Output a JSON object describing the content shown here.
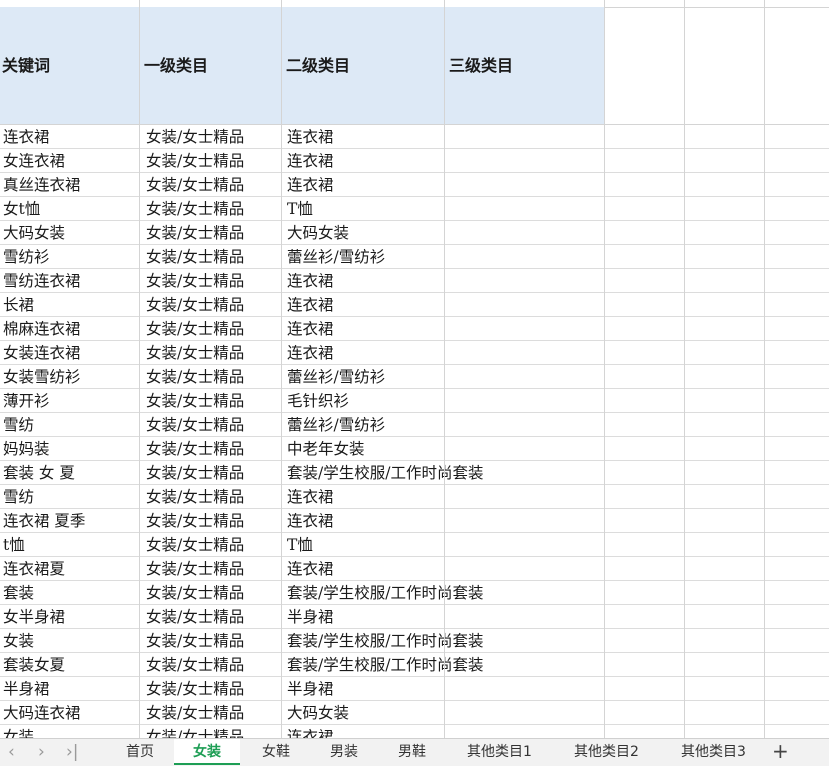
{
  "header": {
    "keyword": "关键词",
    "cat1": "一级类目",
    "cat2": "二级类目",
    "cat3": "三级类目"
  },
  "rows": [
    [
      "连衣裙",
      "女装/女士精品",
      "连衣裙"
    ],
    [
      "女连衣裙",
      "女装/女士精品",
      "连衣裙"
    ],
    [
      "真丝连衣裙",
      "女装/女士精品",
      "连衣裙"
    ],
    [
      "女t恤",
      "女装/女士精品",
      "T恤"
    ],
    [
      "大码女装",
      "女装/女士精品",
      "大码女装"
    ],
    [
      "雪纺衫",
      "女装/女士精品",
      "蕾丝衫/雪纺衫"
    ],
    [
      "雪纺连衣裙",
      "女装/女士精品",
      "连衣裙"
    ],
    [
      "长裙",
      "女装/女士精品",
      "连衣裙"
    ],
    [
      "棉麻连衣裙",
      "女装/女士精品",
      "连衣裙"
    ],
    [
      "女装连衣裙",
      "女装/女士精品",
      "连衣裙"
    ],
    [
      "女装雪纺衫",
      "女装/女士精品",
      "蕾丝衫/雪纺衫"
    ],
    [
      "薄开衫",
      "女装/女士精品",
      "毛针织衫"
    ],
    [
      "雪纺",
      "女装/女士精品",
      "蕾丝衫/雪纺衫"
    ],
    [
      "妈妈装",
      "女装/女士精品",
      "中老年女装"
    ],
    [
      "套装 女 夏",
      "女装/女士精品",
      "套装/学生校服/工作时尚套装"
    ],
    [
      "雪纺",
      "女装/女士精品",
      "连衣裙"
    ],
    [
      "连衣裙 夏季",
      "女装/女士精品",
      "连衣裙"
    ],
    [
      "t恤",
      "女装/女士精品",
      "T恤"
    ],
    [
      "连衣裙夏",
      "女装/女士精品",
      "连衣裙"
    ],
    [
      "套装",
      "女装/女士精品",
      "套装/学生校服/工作时尚套装"
    ],
    [
      "女半身裙",
      "女装/女士精品",
      "半身裙"
    ],
    [
      "女装",
      "女装/女士精品",
      "套装/学生校服/工作时尚套装"
    ],
    [
      "套装女夏",
      "女装/女士精品",
      "套装/学生校服/工作时尚套装"
    ],
    [
      "半身裙",
      "女装/女士精品",
      "半身裙"
    ],
    [
      "大码连衣裙",
      "女装/女士精品",
      "大码女装"
    ],
    [
      "女装",
      "女装/女士精品",
      "连衣裙"
    ]
  ],
  "tabs": [
    "首页",
    "女装",
    "女鞋",
    "男装",
    "男鞋",
    "其他类目1",
    "其他类目2",
    "其他类目3"
  ],
  "active_tab": "女装",
  "colors": {
    "header_bg": "#dde9f6",
    "active_tab": "#1e9e55"
  }
}
